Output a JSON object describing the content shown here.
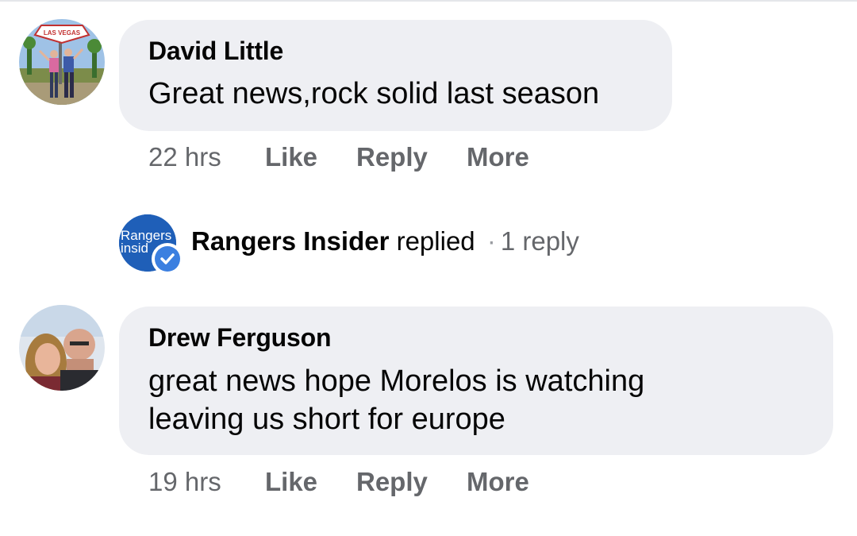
{
  "comments": [
    {
      "author": "David Little",
      "text": "Great news,rock solid last season",
      "time": "22 hrs",
      "avatar_sign_text": "LAS VEGAS",
      "actions": [
        "Like",
        "Reply",
        "More"
      ]
    },
    {
      "author": "Drew Ferguson",
      "text_lines": [
        "great news hope Morelos is watching",
        "leaving us short for europe"
      ],
      "time": "19 hrs",
      "actions": [
        "Like",
        "Reply",
        "More"
      ]
    }
  ],
  "reply_summary": {
    "avatar_line1": "Rangers",
    "avatar_line2": "insid",
    "name": "Rangers Insider",
    "verb": "replied",
    "separator": "·",
    "count": "1 reply",
    "badge_icon": "verified-check-icon"
  },
  "colors": {
    "bubble": "#eeeff3",
    "secondary_text": "#65676b",
    "brand_blue": "#1f5fb8",
    "verified_blue": "#3b7fe0"
  }
}
